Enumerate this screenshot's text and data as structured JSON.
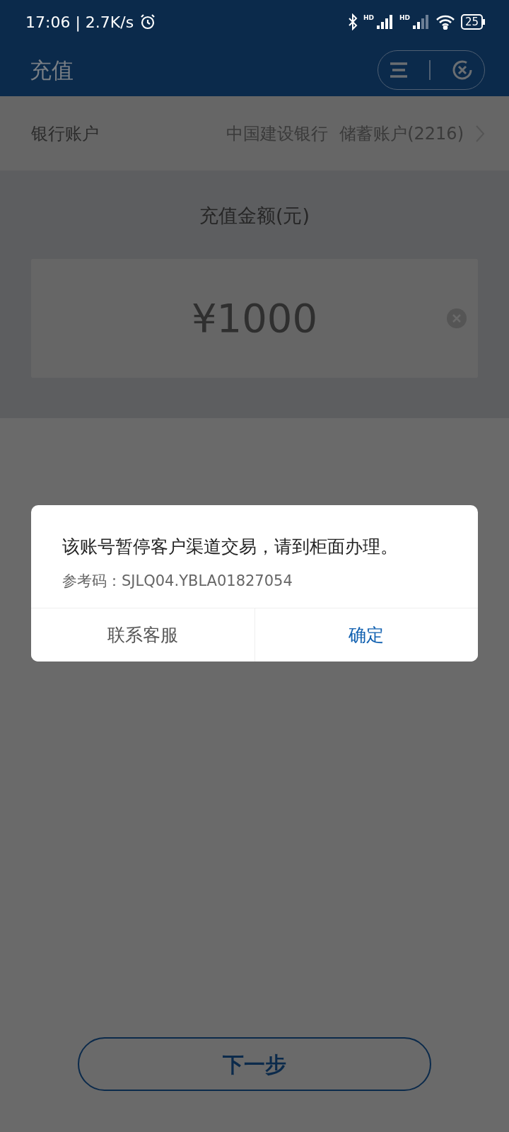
{
  "status_bar": {
    "time_speed": "17:06 | 2.7K/s",
    "signals": [
      {
        "label": "HD",
        "full": true
      },
      {
        "label": "HD",
        "full": false
      }
    ],
    "battery": "25"
  },
  "header": {
    "title": "充值"
  },
  "bank_account": {
    "label": "银行账户",
    "bank": "中国建设银行",
    "account": "储蓄账户(2216)"
  },
  "amount": {
    "label": "充值金额(元)",
    "value": "¥1000"
  },
  "dialog": {
    "message": "该账号暂停客户渠道交易，请到柜面办理。",
    "reference": "参考码：SJLQ04.YBLA01827054",
    "buttons": [
      {
        "label": "联系客服",
        "kind": "secondary"
      },
      {
        "label": "确定",
        "kind": "primary"
      }
    ]
  },
  "next_button": "下一步"
}
